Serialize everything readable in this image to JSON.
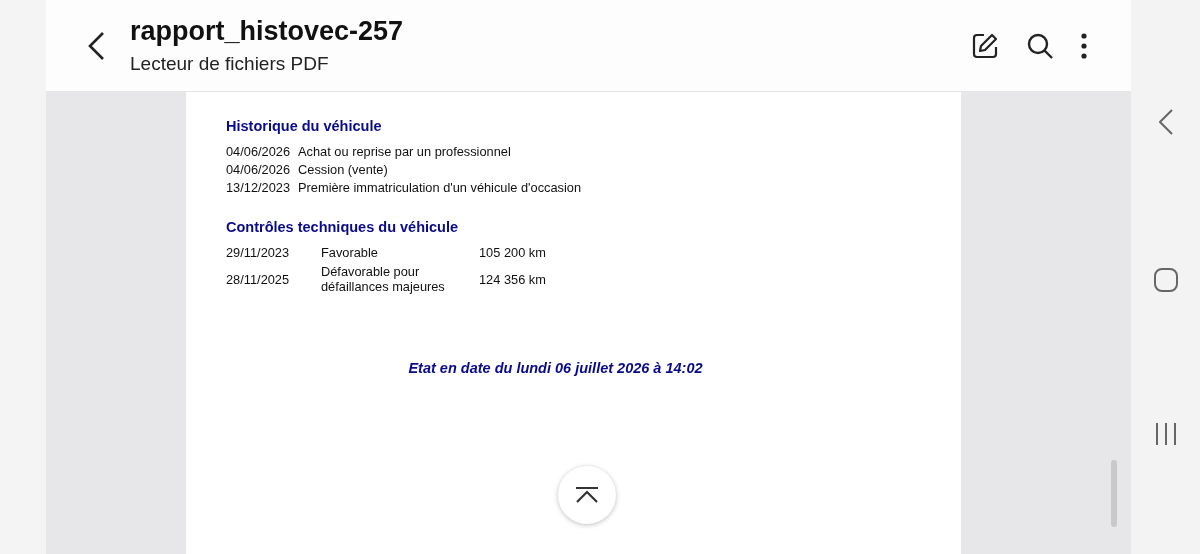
{
  "header": {
    "title": "rapport_histovec-257",
    "subtitle": "Lecteur de fichiers PDF"
  },
  "document": {
    "sections": [
      {
        "kind": "history",
        "heading": "Historique du véhicule",
        "rows": [
          {
            "date": "04/06/2026",
            "event": "Achat ou reprise par un professionnel"
          },
          {
            "date": "04/06/2026",
            "event": "Cession (vente)"
          },
          {
            "date": "13/12/2023",
            "event": "Première immatriculation d'un véhicule d'occasion"
          }
        ]
      },
      {
        "kind": "inspections",
        "heading": "Contrôles techniques du véhicule",
        "rows": [
          {
            "date": "29/11/2023",
            "result": "Favorable",
            "mileage": "105 200 km"
          },
          {
            "date": "28/11/2025",
            "result": "Défavorable pour défaillances majeures",
            "mileage": "124 356 km"
          }
        ]
      }
    ],
    "footer": "Etat en date du lundi 06 juillet 2026 à 14:02"
  }
}
